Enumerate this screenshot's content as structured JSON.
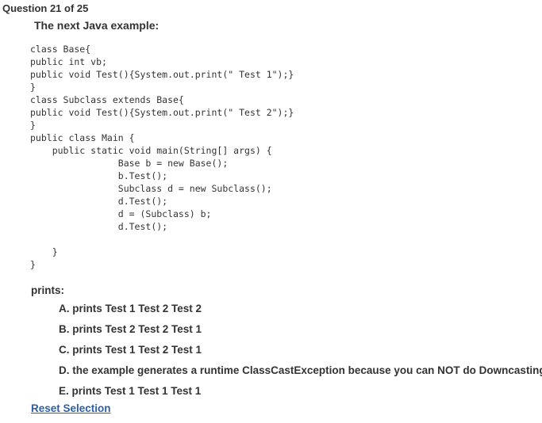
{
  "question": {
    "header": "Question 21 of 25",
    "intro": "The next Java example:"
  },
  "code_lines": [
    "class Base{",
    "public int vb;",
    "public void Test(){System.out.print(\" Test 1\");}",
    "}",
    "class Subclass extends Base{",
    "public void Test(){System.out.print(\" Test 2\");}",
    "}",
    "public class Main {",
    "    public static void main(String[] args) {",
    "                Base b = new Base();",
    "                b.Test();",
    "                Subclass d = new Subclass();",
    "                d.Test();",
    "                d = (Subclass) b;",
    "                d.Test();",
    "",
    "    }",
    "}"
  ],
  "prompt_label": "prints:",
  "options": [
    "A. prints Test 1 Test 2 Test 2",
    "B. prints Test 2 Test 2 Test 1",
    "C. prints Test 1 Test 2 Test 1",
    "D. the example generates a runtime ClassCastException because you can NOT do Downcasting",
    "E. prints Test 1 Test 1 Test 1"
  ],
  "reset_label": "Reset Selection"
}
